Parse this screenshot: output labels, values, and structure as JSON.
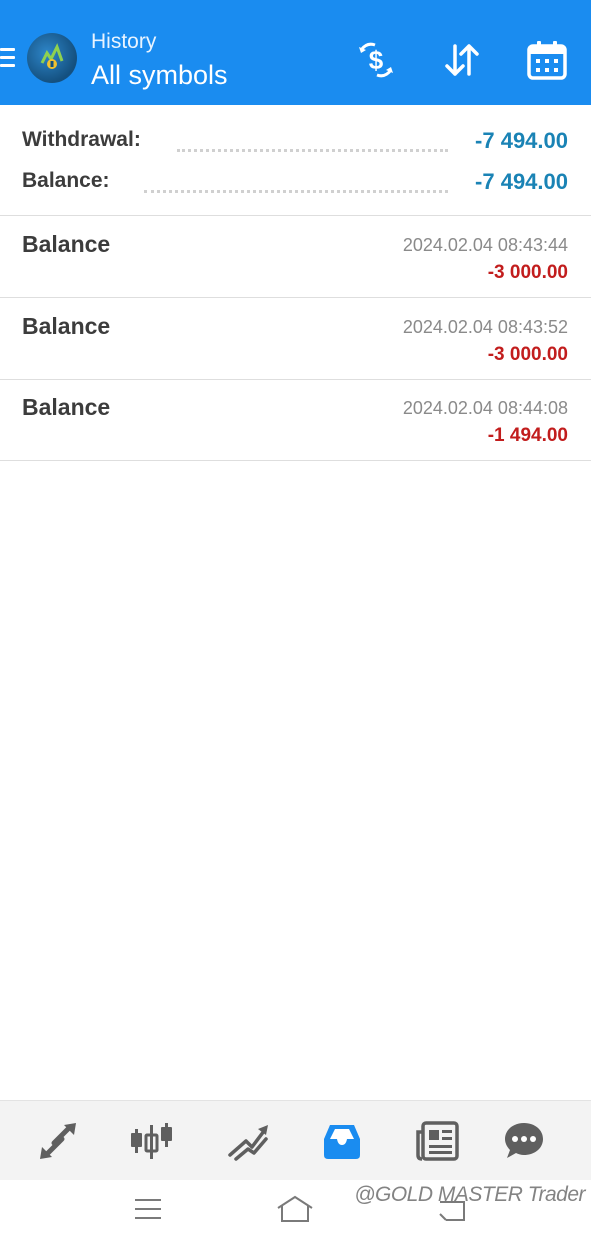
{
  "header": {
    "subtitle": "History",
    "title": "All symbols",
    "icons": [
      "menu-icon",
      "metatrader-logo-icon",
      "currency-exchange-icon",
      "sort-icon",
      "calendar-icon"
    ]
  },
  "summary": {
    "withdrawal_label": "Withdrawal:",
    "withdrawal_value": "-7 494.00",
    "balance_label": "Balance:",
    "balance_value": "-7 494.00"
  },
  "deals": [
    {
      "title": "Balance",
      "time": "2024.02.04 08:43:44",
      "amount": "-3 000.00"
    },
    {
      "title": "Balance",
      "time": "2024.02.04 08:43:52",
      "amount": "-3 000.00"
    },
    {
      "title": "Balance",
      "time": "2024.02.04 08:44:08",
      "amount": "-1 494.00"
    }
  ],
  "bottom_nav": {
    "items": [
      "quotes-icon",
      "chart-icon",
      "trade-icon",
      "history-icon",
      "news-icon",
      "chat-icon"
    ],
    "active": "history-icon"
  },
  "system_nav": {
    "items": [
      "recent-apps-icon",
      "home-icon",
      "back-icon"
    ]
  },
  "watermark": "@GOLD MASTER Trader",
  "colors": {
    "header_bg": "#1a8cf0",
    "summary_value": "#1a83b5",
    "negative_amount": "#c21d1d",
    "active_nav": "#1a8cf0",
    "inactive_nav": "#5f5f5f"
  }
}
